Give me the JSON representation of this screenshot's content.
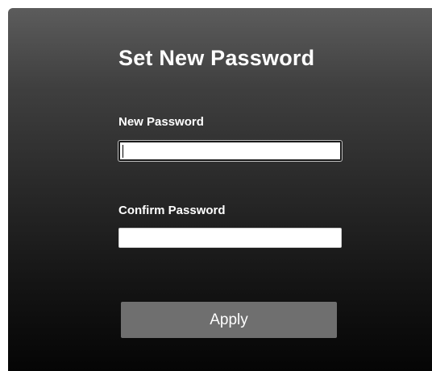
{
  "form": {
    "title": "Set New Password",
    "new_password": {
      "label": "New Password",
      "value": "",
      "placeholder": ""
    },
    "confirm_password": {
      "label": "Confirm Password",
      "value": "",
      "placeholder": ""
    },
    "apply_label": "Apply"
  },
  "colors": {
    "panel_top": "#5c5c5c",
    "panel_bottom": "#050505",
    "button_bg": "#6f6f6f",
    "text": "#ffffff"
  }
}
